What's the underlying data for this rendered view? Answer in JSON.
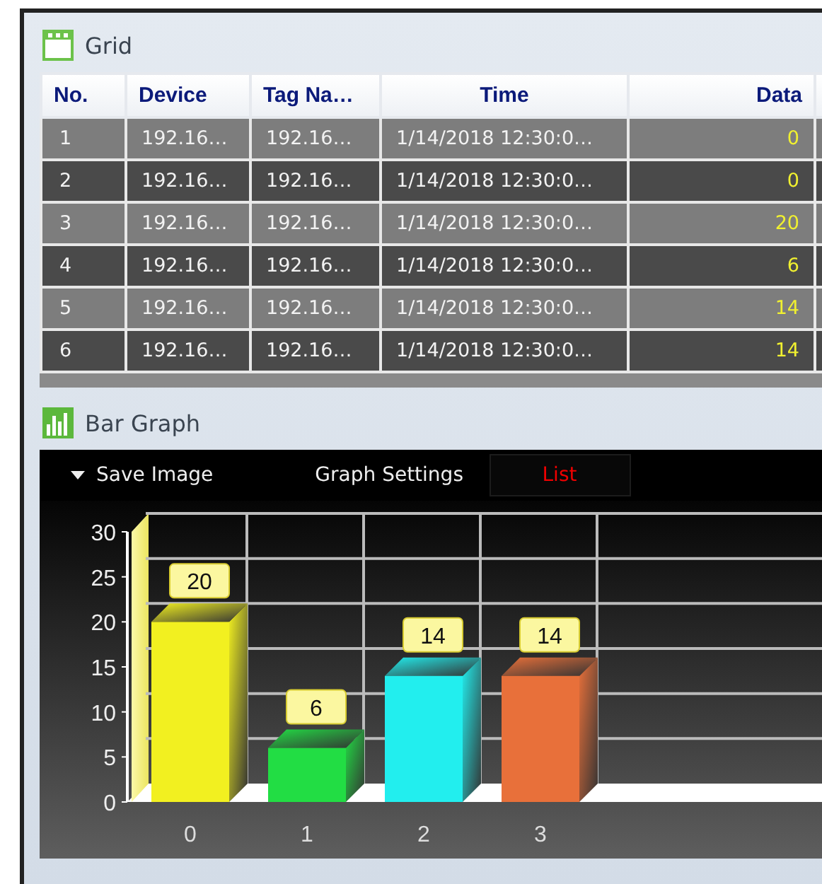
{
  "grid_panel": {
    "title": "Grid",
    "table": {
      "columns": [
        "No.",
        "Device",
        "Tag Na…",
        "Time",
        "Data"
      ],
      "rows": [
        [
          "1",
          "192.16…",
          "192.16…",
          "1/14/2018 12:30:0…",
          "0"
        ],
        [
          "2",
          "192.16…",
          "192.16…",
          "1/14/2018 12:30:0…",
          "0"
        ],
        [
          "3",
          "192.16…",
          "192.16…",
          "1/14/2018 12:30:0…",
          "20"
        ],
        [
          "4",
          "192.16…",
          "192.16…",
          "1/14/2018 12:30:0…",
          "6"
        ],
        [
          "5",
          "192.16…",
          "192.16…",
          "1/14/2018 12:30:0…",
          "14"
        ],
        [
          "6",
          "192.16…",
          "192.16…",
          "1/14/2018 12:30:0…",
          "14"
        ]
      ]
    }
  },
  "graph_panel": {
    "title": "Bar Graph",
    "toolbar": [
      {
        "label": "Save Image",
        "kind": "dropdown",
        "selected": false
      },
      {
        "label": "Graph Settings",
        "kind": "button",
        "selected": false
      },
      {
        "label": "List",
        "kind": "tab",
        "selected": true
      }
    ],
    "chart_data": {
      "type": "bar",
      "categories": [
        "0",
        "1",
        "2",
        "3"
      ],
      "values": [
        20,
        6,
        14,
        14
      ],
      "colors": [
        "#f2f020",
        "#22dd44",
        "#22eeee",
        "#e8703a"
      ],
      "ylim": [
        0,
        30
      ],
      "yticks": [
        0,
        5,
        10,
        15,
        20,
        25,
        30
      ],
      "data_labels": true
    }
  }
}
